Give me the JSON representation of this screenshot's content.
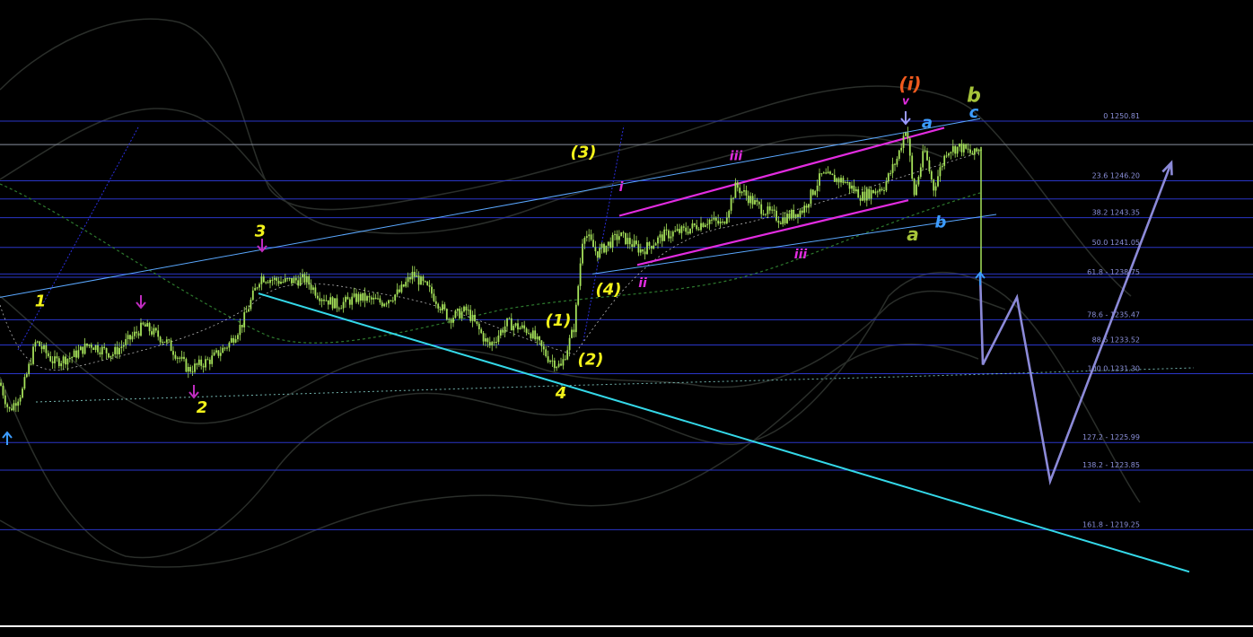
{
  "colors": {
    "background": "#000000",
    "candle": "#a6e35a",
    "fib_line": "#2a36c8",
    "fib_text": "#8a8fd8",
    "envelope": "#2a2e2a",
    "channel_cyan": "#34d8e8",
    "channel_blue": "#5aa8ff",
    "channel_magenta": "#e22ce0",
    "projection": "#8c8ad8",
    "wave_yellow": "#f2f21a",
    "wave_magenta": "#e22ce0",
    "wave_orange": "#f05a1e",
    "wave_olive": "#a6c43a",
    "wave_blue": "#3c9cff",
    "ma_green": "#2e7a2e",
    "ma_white": "#ffffff"
  },
  "chart_data": {
    "type": "candlestick",
    "grid": false,
    "ylim": [
      1217.5,
      1253.5
    ],
    "fib_levels": [
      {
        "text": "0 1250.81",
        "price": 1250.81
      },
      {
        "text": "23.6 1246.20",
        "price": 1246.2
      },
      {
        "text": "38.2 1243.35",
        "price": 1243.35
      },
      {
        "text": "50.0 1241.05",
        "price": 1241.05
      },
      {
        "text": "61.8 - 1238.75",
        "price": 1238.75
      },
      {
        "text": "78.6 - 1235.47",
        "price": 1235.47
      },
      {
        "text": "88.6 1233.52",
        "price": 1233.52
      },
      {
        "text": "100.0 1231.30",
        "price": 1231.3
      },
      {
        "text": "127.2 - 1225.99",
        "price": 1225.99
      },
      {
        "text": "138.2 - 1223.85",
        "price": 1223.85
      },
      {
        "text": "161.8 - 1219.25",
        "price": 1219.25
      }
    ],
    "extra_horizontal_lines": [
      1249.0,
      1244.8,
      1239.0
    ],
    "price_path": [
      [
        0,
        1230.6
      ],
      [
        10,
        1228.4
      ],
      [
        25,
        1230.0
      ],
      [
        40,
        1233.8
      ],
      [
        60,
        1232.2
      ],
      [
        80,
        1232.6
      ],
      [
        100,
        1233.6
      ],
      [
        125,
        1232.8
      ],
      [
        145,
        1234.0
      ],
      [
        160,
        1235.0
      ],
      [
        185,
        1233.8
      ],
      [
        210,
        1231.6
      ],
      [
        235,
        1232.4
      ],
      [
        255,
        1233.6
      ],
      [
        270,
        1235.2
      ],
      [
        290,
        1238.8
      ],
      [
        315,
        1238.4
      ],
      [
        340,
        1238.6
      ],
      [
        355,
        1237.4
      ],
      [
        375,
        1236.6
      ],
      [
        400,
        1237.2
      ],
      [
        425,
        1236.8
      ],
      [
        445,
        1237.6
      ],
      [
        460,
        1239.0
      ],
      [
        480,
        1237.6
      ],
      [
        500,
        1235.6
      ],
      [
        520,
        1236.2
      ],
      [
        545,
        1233.4
      ],
      [
        565,
        1235.2
      ],
      [
        590,
        1234.6
      ],
      [
        610,
        1232.6
      ],
      [
        625,
        1231.8
      ],
      [
        640,
        1235.0
      ],
      [
        650,
        1242.4
      ],
      [
        665,
        1240.6
      ],
      [
        690,
        1242.0
      ],
      [
        715,
        1240.8
      ],
      [
        740,
        1242.0
      ],
      [
        765,
        1242.4
      ],
      [
        790,
        1243.2
      ],
      [
        805,
        1242.8
      ],
      [
        820,
        1245.8
      ],
      [
        845,
        1244.2
      ],
      [
        870,
        1243.2
      ],
      [
        895,
        1244.0
      ],
      [
        915,
        1246.6
      ],
      [
        940,
        1246.2
      ],
      [
        960,
        1245.0
      ],
      [
        985,
        1245.8
      ],
      [
        1000,
        1248.0
      ],
      [
        1010,
        1250.5
      ],
      [
        1018,
        1245.0
      ],
      [
        1030,
        1248.6
      ],
      [
        1040,
        1245.6
      ],
      [
        1055,
        1248.6
      ],
      [
        1070,
        1248.8
      ],
      [
        1085,
        1248.2
      ],
      [
        1093,
        1248.8
      ]
    ],
    "wave_labels": [
      {
        "text": "1",
        "x": 45,
        "price": 1236.5,
        "color": "wave_yellow",
        "size": 18
      },
      {
        "text": "2",
        "x": 225,
        "price": 1228.3,
        "color": "wave_yellow",
        "size": 18
      },
      {
        "text": "3",
        "x": 290,
        "price": 1241.9,
        "color": "wave_yellow",
        "size": 18
      },
      {
        "text": "4",
        "x": 625,
        "price": 1229.4,
        "color": "wave_yellow",
        "size": 18
      },
      {
        "text": "(1)",
        "x": 622,
        "price": 1235.0,
        "color": "wave_yellow",
        "size": 18
      },
      {
        "text": "(2)",
        "x": 658,
        "price": 1232.0,
        "color": "wave_yellow",
        "size": 18
      },
      {
        "text": "(3)",
        "x": 650,
        "price": 1248.0,
        "color": "wave_yellow",
        "size": 18
      },
      {
        "text": "(4)",
        "x": 678,
        "price": 1237.4,
        "color": "wave_yellow",
        "size": 18
      },
      {
        "text": "i",
        "x": 692,
        "price": 1245.4,
        "color": "wave_magenta",
        "size": 14
      },
      {
        "text": "ii",
        "x": 716,
        "price": 1238.0,
        "color": "wave_magenta",
        "size": 14
      },
      {
        "text": "iii",
        "x": 820,
        "price": 1247.8,
        "color": "wave_magenta",
        "size": 14
      },
      {
        "text": "iii",
        "x": 892,
        "price": 1240.2,
        "color": "wave_magenta",
        "size": 14
      },
      {
        "text": "v",
        "x": 1009,
        "price": 1252.1,
        "color": "wave_magenta",
        "size": 12
      },
      {
        "text": "(i)",
        "x": 1014,
        "price": 1253.2,
        "color": "wave_orange",
        "size": 20
      },
      {
        "text": "b",
        "x": 1085,
        "price": 1252.3,
        "color": "wave_olive",
        "size": 22
      },
      {
        "text": "a",
        "x": 1017,
        "price": 1241.6,
        "color": "wave_olive",
        "size": 20
      },
      {
        "text": "a",
        "x": 1033,
        "price": 1250.3,
        "color": "wave_blue",
        "size": 18
      },
      {
        "text": "c",
        "x": 1085,
        "price": 1251.1,
        "color": "wave_blue",
        "size": 18
      },
      {
        "text": "b",
        "x": 1048,
        "price": 1242.6,
        "color": "wave_blue",
        "size": 18
      }
    ],
    "projection_path": [
      [
        1092,
        1239.0
      ],
      [
        1095,
        1232.0
      ],
      [
        1133,
        1237.2
      ],
      [
        1170,
        1223.0
      ],
      [
        1305,
        1247.6
      ]
    ],
    "channel_lines": [
      {
        "from": [
          0,
          1237.2
        ],
        "to": [
          1092,
          1251.0
        ],
        "color": "channel_blue"
      },
      {
        "from": [
          288,
          1237.5
        ],
        "to": [
          1325,
          1216.0
        ],
        "color": "channel_cyan"
      },
      {
        "from": [
          660,
          1239.0
        ],
        "to": [
          1110,
          1243.6
        ],
        "color": "channel_blue"
      },
      {
        "from": [
          690,
          1243.5
        ],
        "to": [
          1052,
          1250.3
        ],
        "color": "channel_magenta"
      },
      {
        "from": [
          710,
          1239.7
        ],
        "to": [
          1012,
          1244.7
        ],
        "color": "channel_magenta"
      }
    ]
  }
}
